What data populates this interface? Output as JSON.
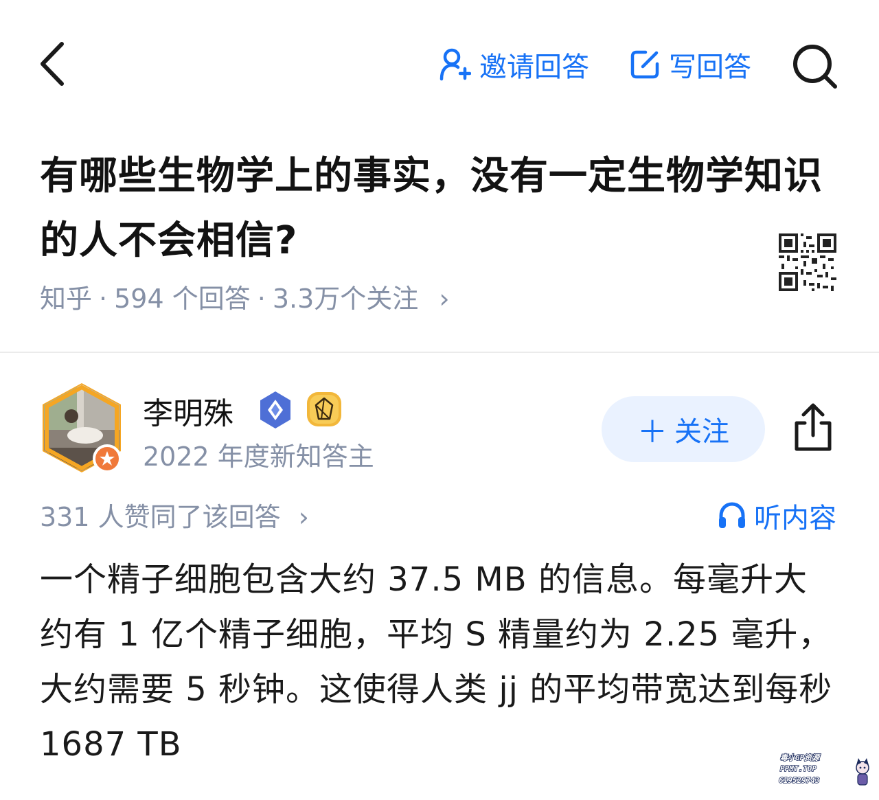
{
  "header": {
    "invite_label": "邀请回答",
    "write_label": "写回答"
  },
  "question": {
    "title": "有哪些生物学上的事实，没有一定生物学知识的人不会相信?",
    "source": "知乎",
    "answers": "594 个回答",
    "followers": "3.3万个关注",
    "chevron": "›"
  },
  "author": {
    "name": "李明殊",
    "description": "2022 年度新知答主",
    "follow_label": "关注",
    "follow_plus": "＋"
  },
  "answer": {
    "votes": "331 人赞同了该回答",
    "votes_chevron": "›",
    "listen_label": "听内容",
    "content": "一个精子细胞包含大约 37.5 MB 的信息。每毫升大约有 1 亿个精子细胞，平均 S 精量约为 2.25 毫升，大约需要 5 秒钟。这使得人类 jj 的平均带宽达到每秒 1687 TB"
  },
  "watermark": {
    "line1": "毒小GP资源",
    "line2": "PPMT.TOP",
    "line3": "619529743"
  },
  "colors": {
    "accent": "#1772f6",
    "meta_gray": "#8590a6",
    "follow_bg": "#eaf2ff",
    "avatar_frame": "#f5a623"
  }
}
